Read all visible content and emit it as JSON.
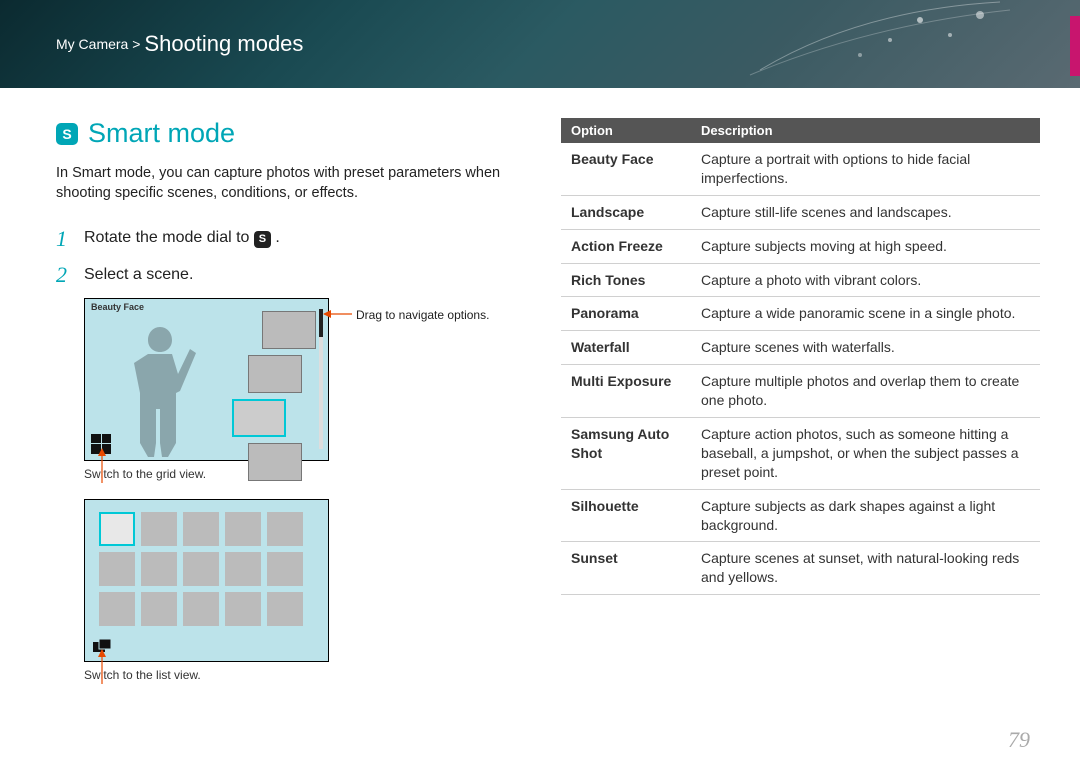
{
  "breadcrumb": {
    "parent": "My Camera >",
    "current": "Shooting modes"
  },
  "heading": "Smart mode",
  "heading_icon": "S",
  "intro": "In Smart mode, you can capture photos with preset parameters when shooting specific scenes, conditions, or effects.",
  "steps": {
    "s1_num": "1",
    "s1_a": "Rotate the mode dial to ",
    "s1_b": ".",
    "s2_num": "2",
    "s2": "Select a scene."
  },
  "fig1": {
    "scene_label": "Beauty Face",
    "callout_drag": "Drag to navigate options.",
    "caption": "Switch to the grid view."
  },
  "fig2": {
    "caption": "Switch to the list view."
  },
  "table": {
    "headers": {
      "option": "Option",
      "desc": "Description"
    },
    "rows": [
      {
        "option": "Beauty Face",
        "desc": "Capture a portrait with options to hide facial imperfections."
      },
      {
        "option": "Landscape",
        "desc": "Capture still-life scenes and landscapes."
      },
      {
        "option": "Action Freeze",
        "desc": "Capture subjects moving at high speed."
      },
      {
        "option": "Rich Tones",
        "desc": "Capture a photo with vibrant colors."
      },
      {
        "option": "Panorama",
        "desc": "Capture a wide panoramic scene in a single photo."
      },
      {
        "option": "Waterfall",
        "desc": "Capture scenes with waterfalls."
      },
      {
        "option": "Multi Exposure",
        "desc": "Capture multiple photos and overlap them to create one photo."
      },
      {
        "option": "Samsung Auto Shot",
        "desc": "Capture action photos, such as someone hitting a baseball, a jumpshot, or when the subject passes a preset point."
      },
      {
        "option": "Silhouette",
        "desc": "Capture subjects as dark shapes against a light background."
      },
      {
        "option": "Sunset",
        "desc": "Capture scenes at sunset, with natural-looking reds and yellows."
      }
    ]
  },
  "page_number": "79",
  "mode_dial_icon": "S"
}
